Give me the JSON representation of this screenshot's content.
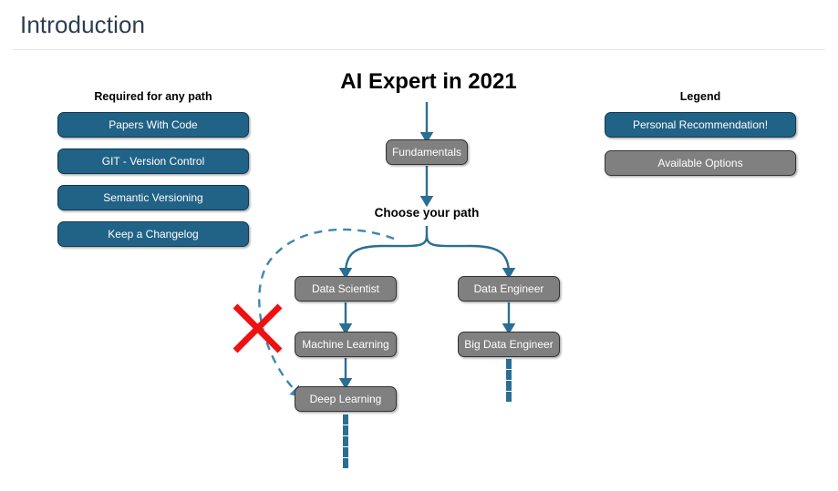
{
  "header": {
    "title": "Introduction"
  },
  "required_section": {
    "caption": "Required for any path",
    "items": [
      {
        "label": "Papers With Code"
      },
      {
        "label": "GIT - Version Control"
      },
      {
        "label": "Semantic Versioning"
      },
      {
        "label": "Keep a Changelog"
      }
    ]
  },
  "legend": {
    "caption": "Legend",
    "items": [
      {
        "label": "Personal Recommendation!",
        "style": "teal"
      },
      {
        "label": "Available Options",
        "style": "gray"
      }
    ]
  },
  "flowchart": {
    "title": "AI Expert in 2021",
    "branch_label": "Choose your path",
    "nodes": [
      {
        "id": "fundamentals",
        "label": "Fundamentals"
      },
      {
        "id": "data_scientist",
        "label": "Data Scientist"
      },
      {
        "id": "machine_learning",
        "label": "Machine Learning"
      },
      {
        "id": "deep_learning",
        "label": "Deep Learning"
      },
      {
        "id": "data_engineer",
        "label": "Data Engineer"
      },
      {
        "id": "big_data_engineer",
        "label": "Big Data Engineer"
      }
    ],
    "markers": [
      {
        "id": "not-recommended-x",
        "name": "red-x-icon"
      }
    ]
  },
  "colors": {
    "accent_teal": "#216287",
    "node_gray": "#808080",
    "node_border": "#333333",
    "title_slate": "#2e3d50",
    "red_x": "#ee1111",
    "rule": "#e4e6e8",
    "background": "#ffffff"
  }
}
